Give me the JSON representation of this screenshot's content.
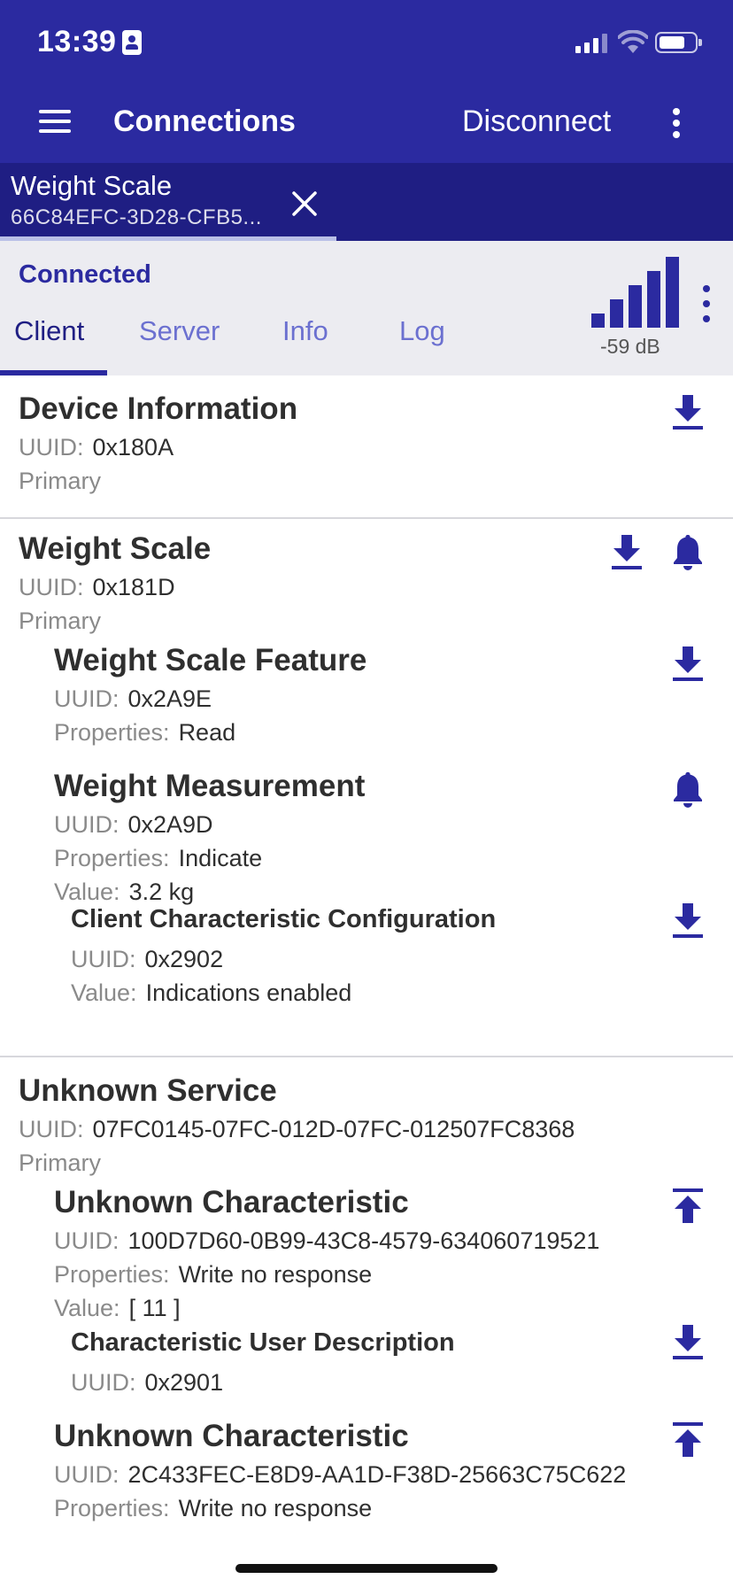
{
  "status_bar": {
    "time": "13:39"
  },
  "app_bar": {
    "title": "Connections",
    "disconnect_label": "Disconnect"
  },
  "device_tab": {
    "name": "Weight Scale",
    "id": "66C84EFC-3D28-CFB5..."
  },
  "connection": {
    "status": "Connected",
    "rssi": "-59 dB",
    "tabs": [
      "Client",
      "Server",
      "Info",
      "Log"
    ],
    "active_tab": "Client"
  },
  "colors": {
    "primary": "#2b2aa0",
    "primary_dark": "#1f1e83",
    "tab_inactive": "#6b70d0",
    "header_bg": "#ececf1"
  },
  "labels": {
    "uuid": "UUID:",
    "properties": "Properties:",
    "value": "Value:"
  },
  "services": [
    {
      "name": "Device Information",
      "uuid": "0x180A",
      "type": "Primary"
    },
    {
      "name": "Weight Scale",
      "uuid": "0x181D",
      "type": "Primary",
      "characteristics": [
        {
          "name": "Weight Scale Feature",
          "uuid": "0x2A9E",
          "properties": "Read"
        },
        {
          "name": "Weight Measurement",
          "uuid": "0x2A9D",
          "properties": "Indicate",
          "value": "3.2 kg",
          "descriptors": [
            {
              "name": "Client Characteristic Configuration",
              "uuid": "0x2902",
              "value": "Indications enabled"
            }
          ]
        }
      ]
    },
    {
      "name": "Unknown Service",
      "uuid": "07FC0145-07FC-012D-07FC-012507FC8368",
      "type": "Primary",
      "characteristics": [
        {
          "name": "Unknown Characteristic",
          "uuid": "100D7D60-0B99-43C8-4579-634060719521",
          "properties": "Write no response",
          "value": "[ 11 ]",
          "descriptors": [
            {
              "name": "Characteristic User Description",
              "uuid": "0x2901"
            }
          ]
        },
        {
          "name": "Unknown Characteristic",
          "uuid": "2C433FEC-E8D9-AA1D-F38D-25663C75C622",
          "properties": "Write no response"
        }
      ]
    }
  ],
  "icons": {
    "read": "download-icon",
    "notify": "bell-icon",
    "write": "upload-icon"
  }
}
